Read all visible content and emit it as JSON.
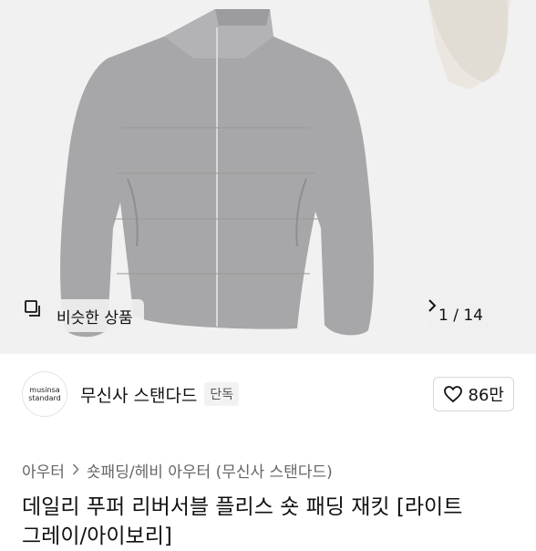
{
  "gallery": {
    "similar_label": "비슷한 상품",
    "counter": "1 / 14",
    "product_image": "gray-puffer-jacket"
  },
  "brand": {
    "logo_line1": "musinsa",
    "logo_line2": "standard",
    "name": "무신사 스탠다드",
    "badge": "단독",
    "likes": "86만"
  },
  "breadcrumb": {
    "level1": "아우터",
    "level2": "숏패딩/헤비 아우터 (무신사 스탠다드)"
  },
  "product": {
    "title_line1": "데일리 푸퍼 리버서블 플리스 숏 패딩 재킷 [라이트",
    "title_line2": "그레이/아이보리]"
  }
}
